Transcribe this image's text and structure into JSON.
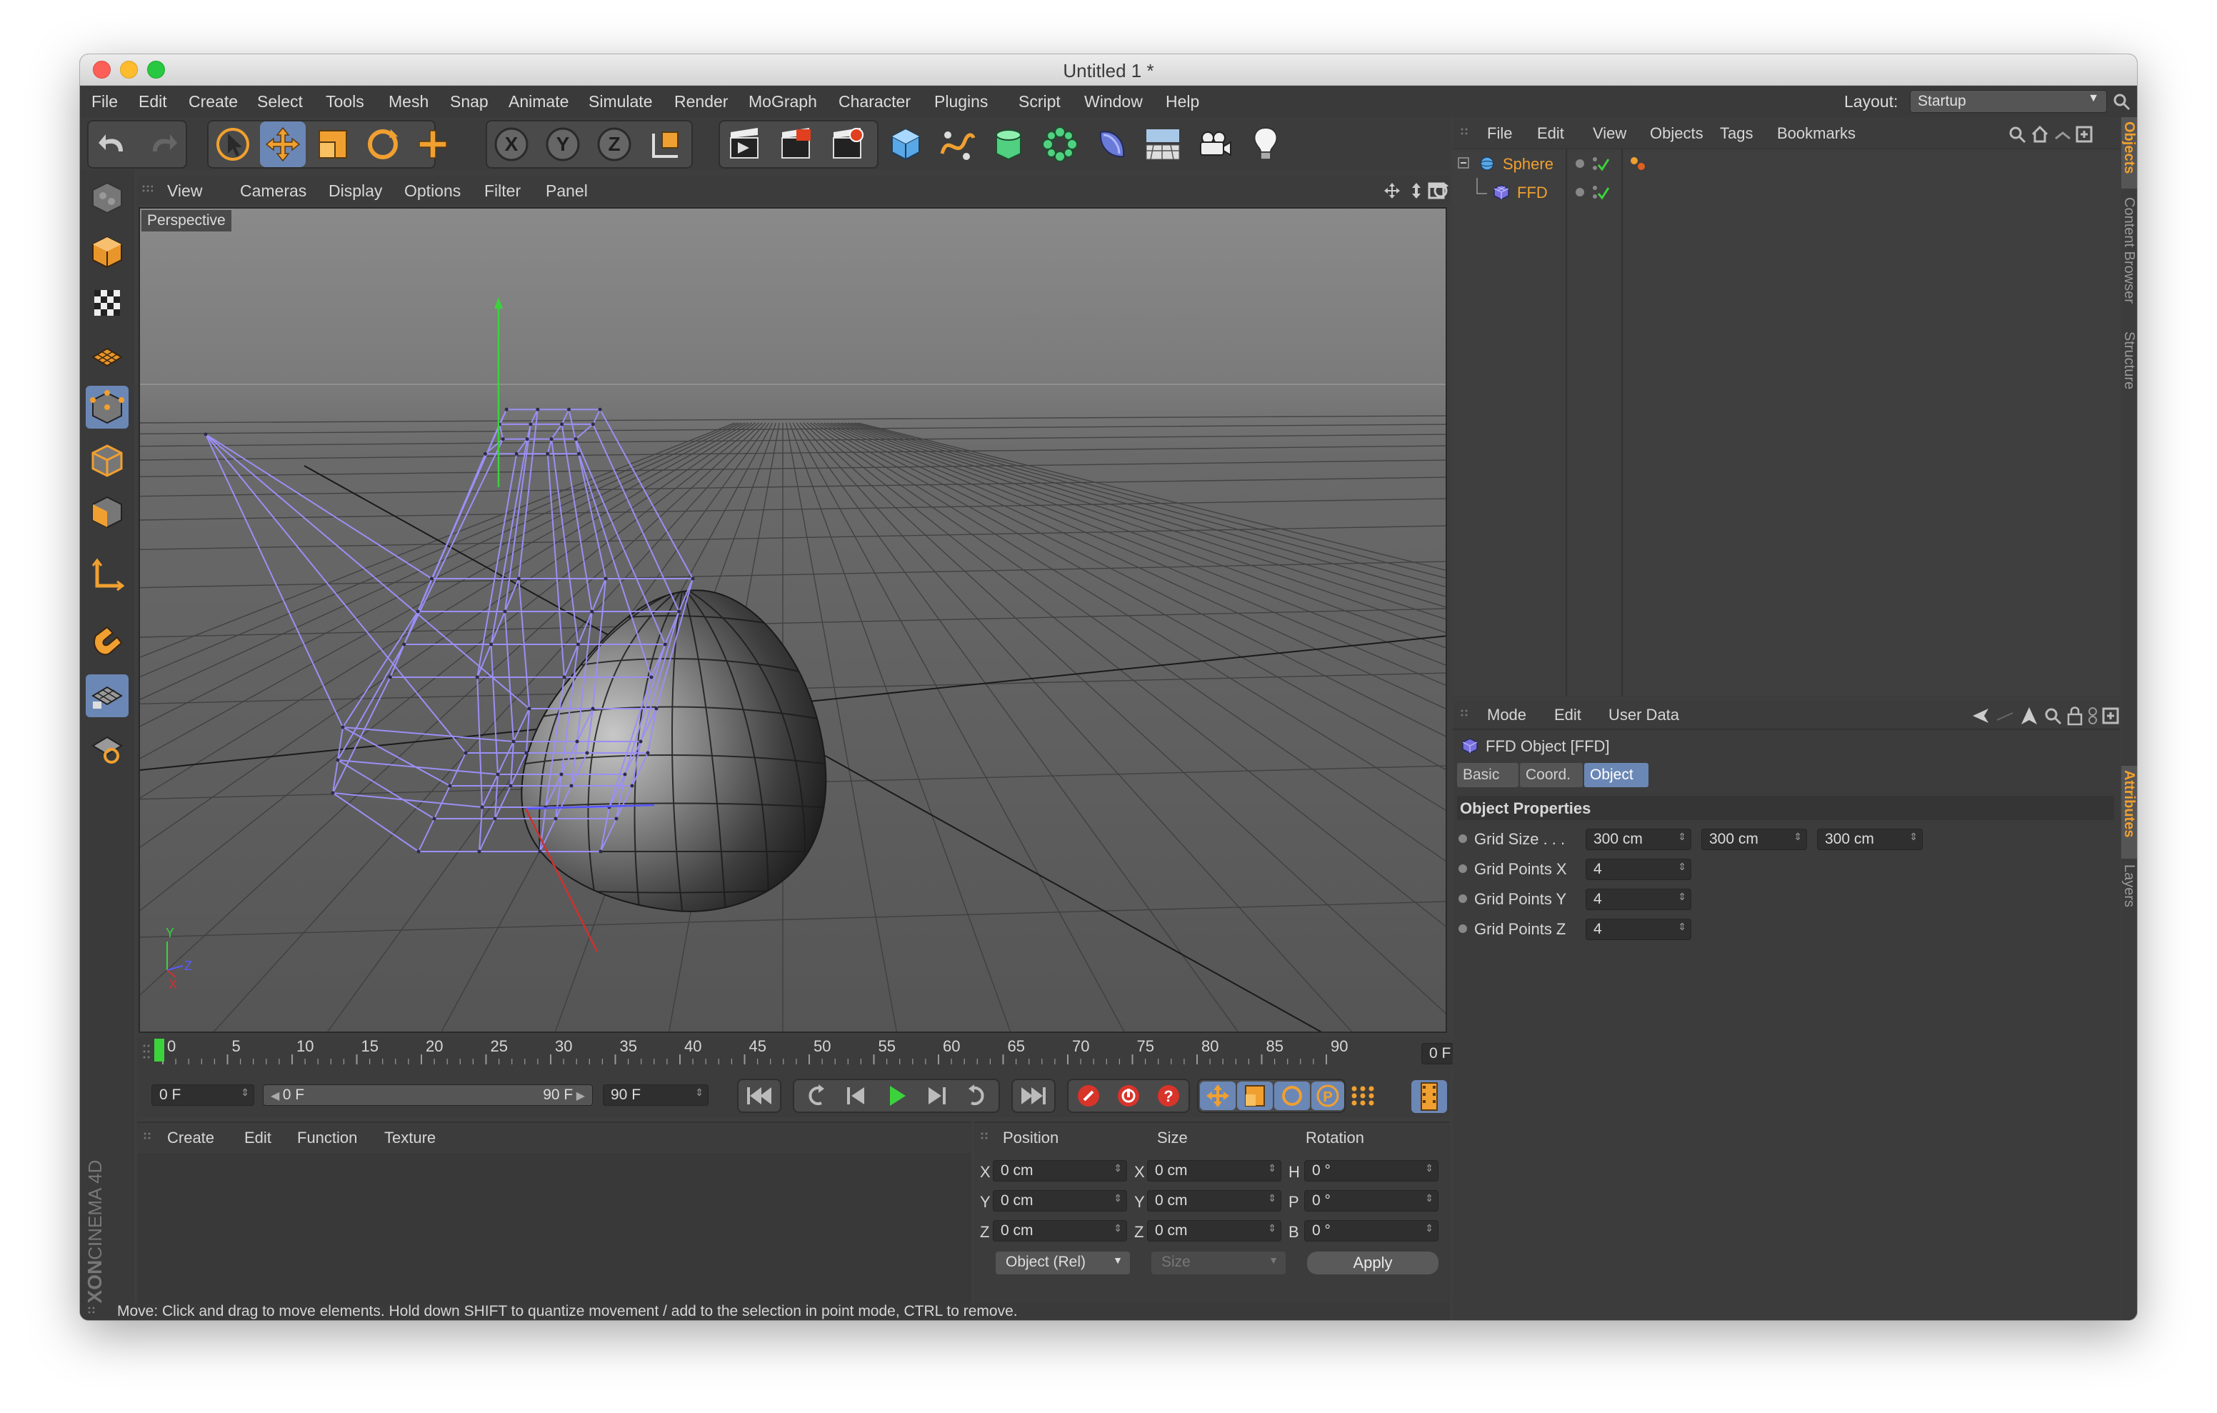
{
  "window": {
    "title": "Untitled 1 *"
  },
  "menubar": {
    "items": [
      "File",
      "Edit",
      "Create",
      "Select",
      "Tools",
      "Mesh",
      "Snap",
      "Animate",
      "Simulate",
      "Render",
      "MoGraph",
      "Character",
      "Plugins",
      "Script",
      "Window",
      "Help"
    ],
    "layout_label": "Layout:",
    "layout_value": "Startup"
  },
  "toolbar_icons": [
    "undo-icon",
    "redo-icon",
    "select-icon",
    "move-icon",
    "scale-icon",
    "rotate-icon",
    "live-add-icon",
    "x-axis-icon",
    "y-axis-icon",
    "z-axis-icon",
    "coordinate-system-icon",
    "render-view-icon",
    "render-picture-viewer-icon",
    "render-settings-icon",
    "cube-icon",
    "spline-icon",
    "nurbs-icon",
    "array-icon",
    "deformer-icon",
    "floor-icon",
    "camera-icon",
    "light-icon"
  ],
  "toolbar_axes": [
    "X",
    "Y",
    "Z"
  ],
  "viewport": {
    "menu": [
      "View",
      "Cameras",
      "Display",
      "Options",
      "Filter",
      "Panel"
    ],
    "label": "Perspective",
    "axis_y": "Y",
    "axis_z": "Z",
    "axis_x": "X"
  },
  "timeline": {
    "ticks": [
      "0",
      "5",
      "10",
      "15",
      "20",
      "25",
      "30",
      "35",
      "40",
      "45",
      "50",
      "55",
      "60",
      "65",
      "70",
      "75",
      "80",
      "85",
      "90"
    ],
    "current_frame": "0 F",
    "start_field": "0 F",
    "range_start": "0 F",
    "range_end": "90 F",
    "end_field": "90 F"
  },
  "materials": {
    "menu": [
      "Create",
      "Edit",
      "Function",
      "Texture"
    ]
  },
  "coords": {
    "headers": [
      "Position",
      "Size",
      "Rotation"
    ],
    "rows": [
      {
        "axis": "X",
        "pos": "0 cm",
        "size_axis": "X",
        "size": "0 cm",
        "rot_axis": "H",
        "rot": "0 °"
      },
      {
        "axis": "Y",
        "pos": "0 cm",
        "size_axis": "Y",
        "size": "0 cm",
        "rot_axis": "P",
        "rot": "0 °"
      },
      {
        "axis": "Z",
        "pos": "0 cm",
        "size_axis": "Z",
        "size": "0 cm",
        "rot_axis": "B",
        "rot": "0 °"
      }
    ],
    "mode": "Object (Rel)",
    "size_mode": "Size",
    "apply": "Apply"
  },
  "brand": {
    "maxon": "MAXON",
    "cinema": "CINEMA 4D"
  },
  "status": "Move: Click and drag to move elements. Hold down SHIFT to quantize movement / add to the selection in point mode, CTRL to remove.",
  "objects_panel": {
    "menu": [
      "File",
      "Edit",
      "View",
      "Objects",
      "Tags",
      "Bookmarks"
    ],
    "items": [
      {
        "name": "Sphere"
      },
      {
        "name": "FFD"
      }
    ],
    "tabs": [
      "Objects",
      "Content Browser",
      "Structure"
    ]
  },
  "attributes": {
    "menu": [
      "Mode",
      "Edit",
      "User Data"
    ],
    "object_title": "FFD Object [FFD]",
    "tabs": [
      "Basic",
      "Coord.",
      "Object"
    ],
    "section": "Object Properties",
    "grid_size_label": "Grid Size . . .",
    "grid_size": [
      "300 cm",
      "300 cm",
      "300 cm"
    ],
    "rows": [
      {
        "label": "Grid Points X",
        "value": "4"
      },
      {
        "label": "Grid Points Y",
        "value": "4"
      },
      {
        "label": "Grid Points Z",
        "value": "4"
      }
    ],
    "side_tabs": [
      "Attributes",
      "Layers"
    ]
  },
  "colors": {
    "accent_orange": "#f0a030",
    "selection_blue": "#6b87b5",
    "ffd_lattice": "#9b8ff5"
  }
}
